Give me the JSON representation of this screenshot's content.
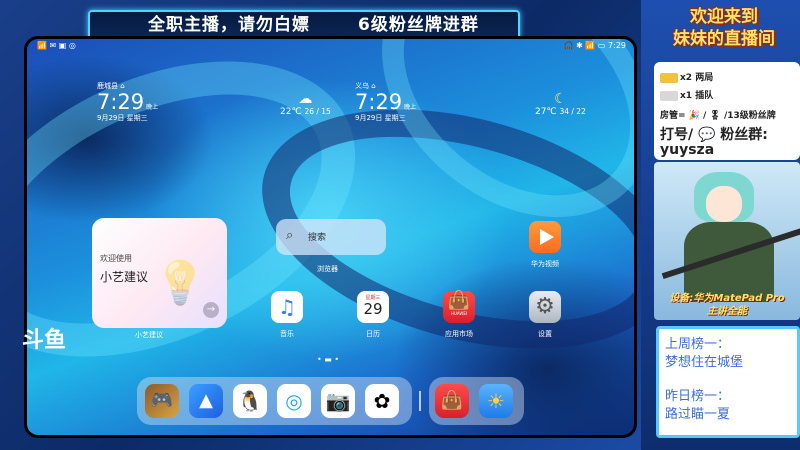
{
  "banner": {
    "part1": "全职主播，请勿白嫖",
    "part2": "6级粉丝牌进群"
  },
  "statusbar": {
    "left": "📶 ✉ ▣ ◎",
    "right": "🎧 ✱ 📶 ▭ 7:29"
  },
  "clock1": {
    "city": "鹿城县 ⌂",
    "time": "7:29",
    "ampm": "晚上",
    "date": "9月29日 星期三"
  },
  "weather1": {
    "icon": "☁",
    "temp": "22℃",
    "range": "26 / 15"
  },
  "clock2": {
    "city": "义乌 ⌂",
    "time": "7:29",
    "ampm": "晚上",
    "date": "9月29日 星期三"
  },
  "weather2": {
    "icon": "☾",
    "temp": "27℃",
    "range": "34 / 22"
  },
  "widget": {
    "title": "欢迎使用",
    "name": "小艺建议",
    "label": "小艺建议"
  },
  "search": {
    "placeholder": "搜索",
    "label": "浏览器"
  },
  "apps": [
    {
      "label": "华为视频"
    },
    {
      "label": "音乐"
    },
    {
      "label": "日历",
      "weekday": "星期三",
      "day": "29"
    },
    {
      "label": "应用市场",
      "brand": "HUAWEI"
    },
    {
      "label": "设置"
    }
  ],
  "douyu": "斗鱼",
  "panel": {
    "welcome1": "欢迎来到",
    "welcome2": "妹妹的直播间",
    "line1": "x2 两局",
    "line2": "x1 插队",
    "line3": "房管= 🎉 / 🎖 /13级粉丝牌",
    "line4": "打号/ 💬 粉丝群:",
    "line5": "yuysza",
    "equip1": "设备:华为MatePad Pro",
    "equip2": "主讲全能",
    "rank1": "上周榜一：",
    "rank1_name": "梦想住在城堡",
    "rank2": "昨日榜一：",
    "rank2_name": "路过瞄一夏"
  },
  "colors": {
    "accent": "#4fd3ff",
    "welcome": "#ffe36b",
    "rank_text": "#3b6fd6"
  }
}
